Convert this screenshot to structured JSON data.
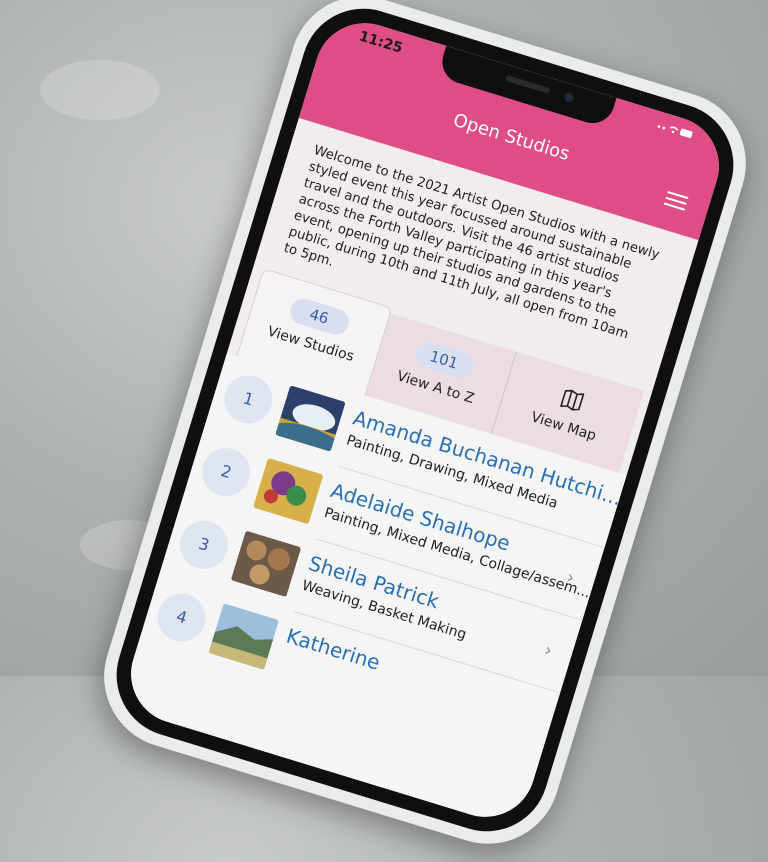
{
  "status_bar": {
    "time": "11:25"
  },
  "header": {
    "title": "Open Studios"
  },
  "intro_text": "Welcome to the 2021 Artist Open Studios with a newly styled event this year focussed around sustainable travel and the outdoors. Visit the 46 artist studios across the Forth Valley participating in this year's event, opening up their studios and gardens to the public, during 10th and 11th July, all open from 10am to 5pm.",
  "tabs": [
    {
      "count": "46",
      "label": "View Studios"
    },
    {
      "count": "101",
      "label": "View A to Z"
    },
    {
      "label": "View Map",
      "icon": "map-icon"
    }
  ],
  "artists": [
    {
      "number": "1",
      "name": "Amanda Buchanan Hutchi...",
      "categories": "Painting, Drawing, Mixed Media"
    },
    {
      "number": "2",
      "name": "Adelaide Shalhope",
      "categories": "Painting, Mixed Media, Collage/assem..."
    },
    {
      "number": "3",
      "name": "Sheila Patrick",
      "categories": "Weaving, Basket Making"
    },
    {
      "number": "4",
      "name": "Katherine",
      "categories": ""
    }
  ],
  "colors": {
    "accent": "#de4d86",
    "link": "#2a6fb3",
    "badge_bg": "#d8dff0"
  }
}
